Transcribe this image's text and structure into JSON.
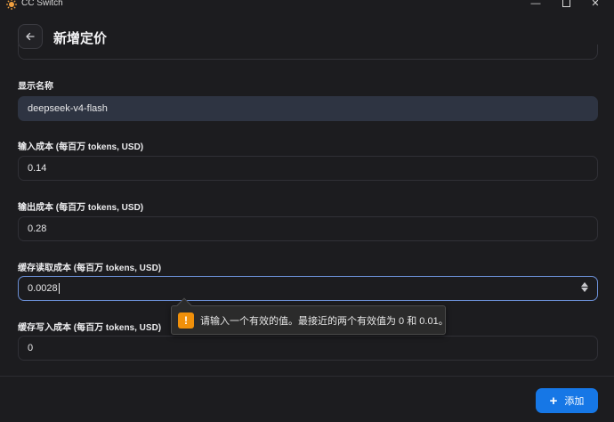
{
  "window": {
    "title": "CC Switch",
    "min_glyph": "—",
    "close_glyph": "✕"
  },
  "header": {
    "title": "新增定价",
    "back_glyph": "←"
  },
  "form": {
    "display_name": {
      "label": "显示名称",
      "value": "deepseek-v4-flash"
    },
    "input_cost": {
      "label": "输入成本 (每百万 tokens, USD)",
      "value": "0.14"
    },
    "output_cost": {
      "label": "输出成本 (每百万 tokens, USD)",
      "value": "0.28"
    },
    "cache_read_cost": {
      "label": "缓存读取成本 (每百万 tokens, USD)",
      "value": "0.0028"
    },
    "cache_write_cost": {
      "label": "缓存写入成本 (每百万 tokens, USD)",
      "value": "0"
    }
  },
  "validation": {
    "icon": "!",
    "message": "请输入一个有效的值。最接近的两个有效值为 0 和 0.01。"
  },
  "footer": {
    "add_icon": "+",
    "add_label": "添加"
  },
  "colors": {
    "accent": "#1677e6",
    "warning": "#f0900a",
    "focus": "#6b8fd6"
  }
}
